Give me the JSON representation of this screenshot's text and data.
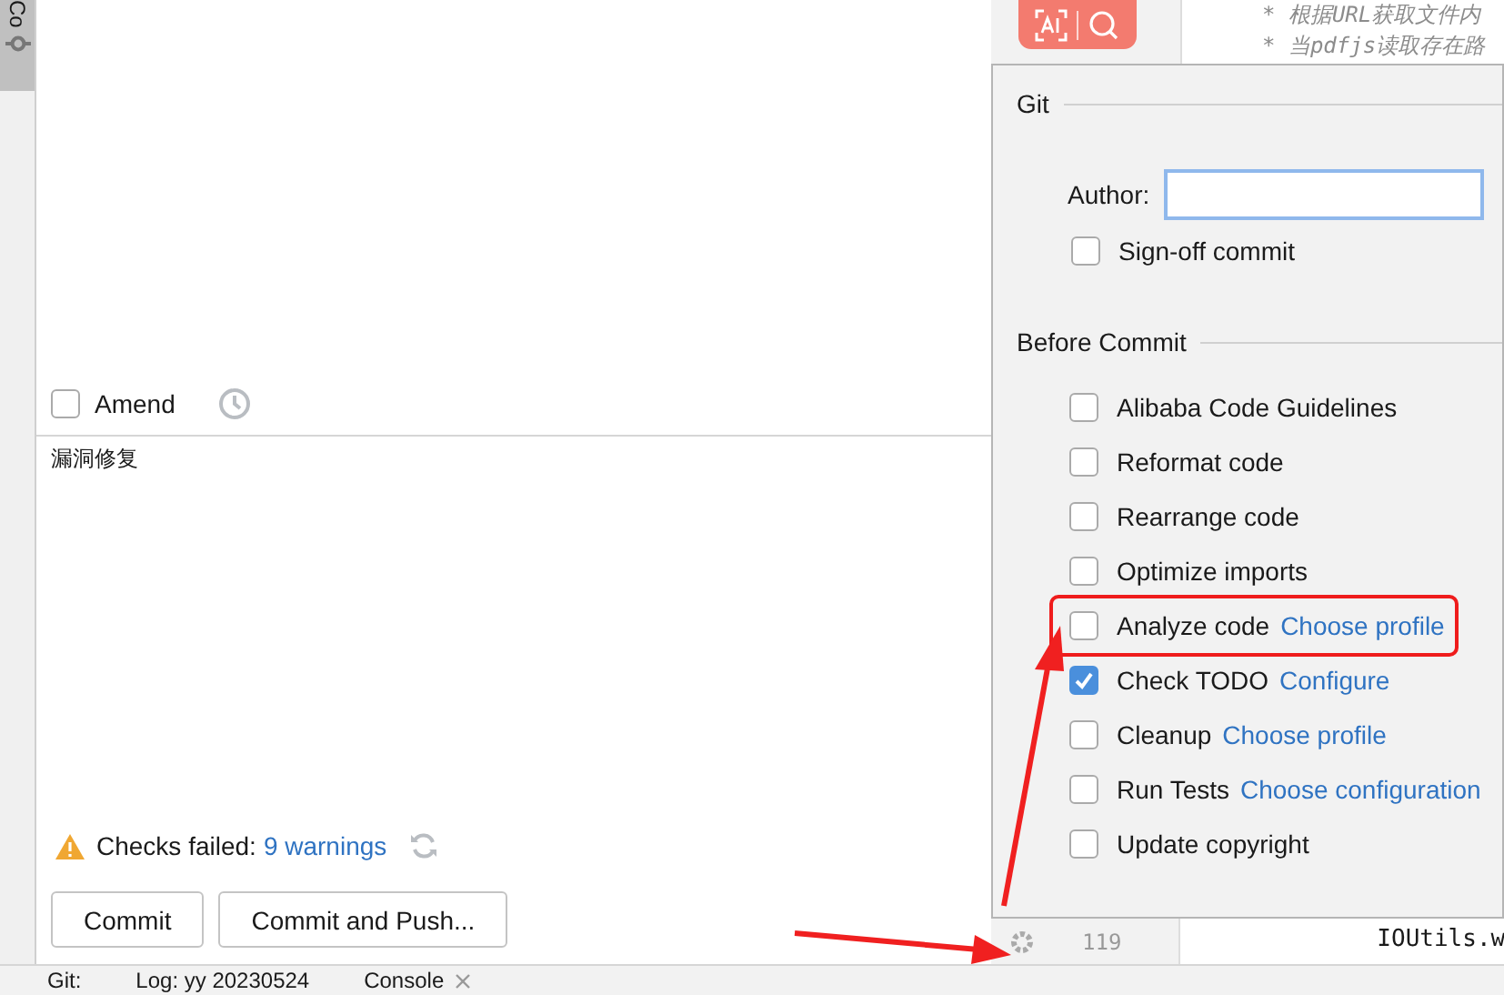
{
  "tool_strip": {
    "label": "Co"
  },
  "commit_panel": {
    "amend": {
      "label": "Amend",
      "checked": false
    },
    "message": "漏洞修复",
    "checks": {
      "label": "Checks failed:",
      "link": "9 warnings"
    },
    "buttons": [
      {
        "label": "Commit"
      },
      {
        "label": "Commit and Push..."
      }
    ]
  },
  "editor": {
    "comment_lines": [
      "* 根据URL获取文件内",
      "* 当pdfjs读取存在路"
    ],
    "bottom_line": {
      "number": "119",
      "code": "IOUtils.w"
    }
  },
  "popup": {
    "git": {
      "title": "Git",
      "author": {
        "label": "Author:"
      },
      "sign_off": {
        "label": "Sign-off commit",
        "checked": false
      }
    },
    "before_commit": {
      "title": "Before Commit",
      "items": [
        {
          "label": "Alibaba Code Guidelines",
          "checked": false,
          "highlighted": false
        },
        {
          "label": "Reformat code",
          "checked": false,
          "highlighted": false
        },
        {
          "label": "Rearrange code",
          "checked": false,
          "highlighted": false
        },
        {
          "label": "Optimize imports",
          "checked": false,
          "highlighted": false
        },
        {
          "label": "Analyze code",
          "link": "Choose profile",
          "checked": false,
          "highlighted": true
        },
        {
          "label": "Check TODO",
          "link": "Configure",
          "checked": true,
          "highlighted": false
        },
        {
          "label": "Cleanup",
          "link": "Choose profile",
          "checked": false,
          "highlighted": false
        },
        {
          "label": "Run Tests",
          "link": "Choose configuration",
          "checked": false,
          "highlighted": false
        },
        {
          "label": "Update copyright",
          "checked": false,
          "highlighted": false
        }
      ]
    }
  },
  "status_bar": {
    "tabs": [
      {
        "label": "Git:"
      },
      {
        "label": "Log: yy 20230524"
      },
      {
        "label": "Console"
      }
    ]
  }
}
